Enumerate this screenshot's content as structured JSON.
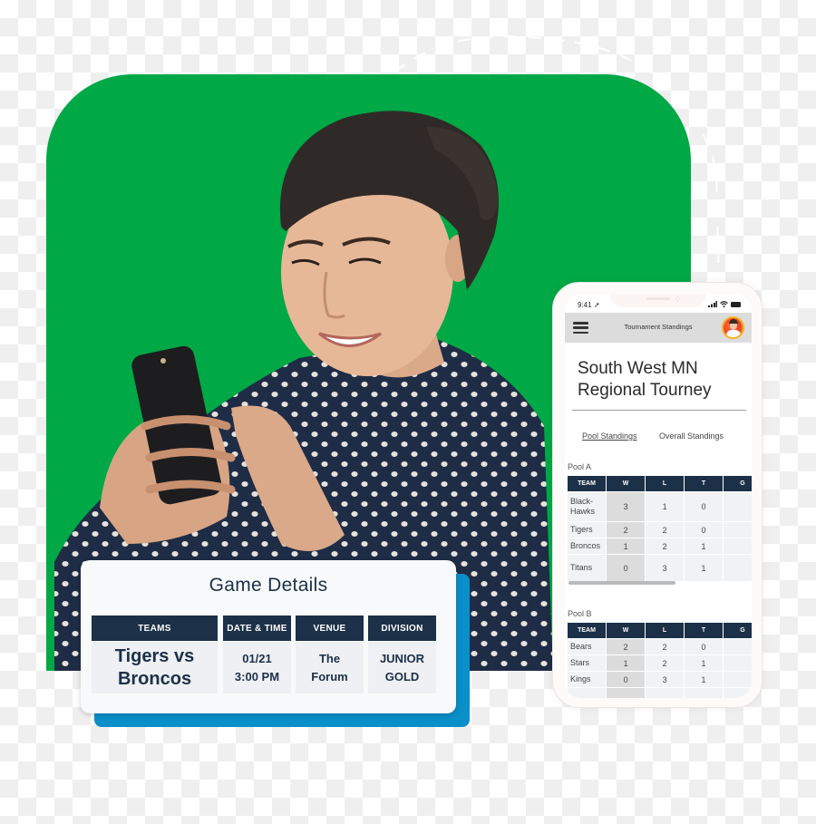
{
  "colors": {
    "green": "#00a846",
    "navy": "#1c3048",
    "blue_accent": "#0a8fc9",
    "avatar_ring": "#f4b31e"
  },
  "game_details": {
    "title": "Game Details",
    "columns": [
      {
        "header": "TEAMS",
        "lines": [
          "Tigers vs",
          "Broncos"
        ]
      },
      {
        "header": "DATE & TIME",
        "lines": [
          "01/21",
          "3:00 PM"
        ]
      },
      {
        "header": "VENUE",
        "lines": [
          "The",
          "Forum"
        ]
      },
      {
        "header": "DIVISION",
        "lines": [
          "JUNIOR",
          "GOLD"
        ]
      }
    ]
  },
  "phone": {
    "status_time": "9:41",
    "status_icons": [
      "location-arrow-icon",
      "signal-icon",
      "wifi-icon",
      "battery-icon"
    ],
    "app_bar_title": "Tournament Standings",
    "menu_icon": "hamburger-menu-icon",
    "avatar_icon": "user-avatar",
    "tourney_title_line1": "South West MN",
    "tourney_title_line2": "Regional Tourney",
    "tabs": [
      {
        "label": "Pool Standings",
        "active": true
      },
      {
        "label": "Overall Standings",
        "active": false
      }
    ],
    "pools": [
      {
        "label": "Pool A",
        "headers": [
          "TEAM",
          "W",
          "L",
          "T",
          "G"
        ],
        "rows": [
          {
            "team": [
              "Black-",
              "Hawks"
            ],
            "w": "3",
            "l": "1",
            "t": "0"
          },
          {
            "team": [
              "Tigers"
            ],
            "w": "2",
            "l": "2",
            "t": "0"
          },
          {
            "team": [
              "Broncos"
            ],
            "w": "1",
            "l": "2",
            "t": "1"
          },
          {
            "team": [
              "Titans"
            ],
            "w": "0",
            "l": "3",
            "t": "1"
          }
        ]
      },
      {
        "label": "Pool B",
        "headers": [
          "TEAM",
          "W",
          "L",
          "T",
          "G"
        ],
        "rows": [
          {
            "team": [
              "Bears"
            ],
            "w": "2",
            "l": "2",
            "t": "0"
          },
          {
            "team": [
              "Stars"
            ],
            "w": "1",
            "l": "2",
            "t": "1"
          },
          {
            "team": [
              "Kings"
            ],
            "w": "0",
            "l": "3",
            "t": "1"
          },
          {
            "team": [
              ""
            ],
            "w": "",
            "l": "",
            "t": ""
          }
        ]
      }
    ]
  }
}
